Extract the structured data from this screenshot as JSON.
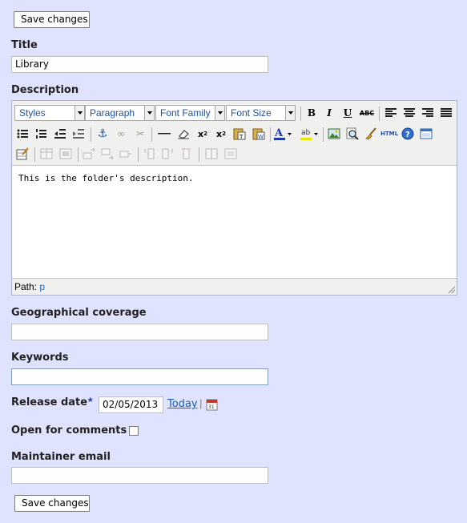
{
  "buttons": {
    "save_top": "Save changes",
    "save_bottom": "Save changes"
  },
  "fields": {
    "title": {
      "label": "Title",
      "value": "Library"
    },
    "description": {
      "label": "Description"
    },
    "geo": {
      "label": "Geographical coverage",
      "value": ""
    },
    "keywords": {
      "label": "Keywords",
      "value": ""
    },
    "release": {
      "label": "Release date",
      "required_mark": "*",
      "value": "02/05/2013",
      "today": "Today",
      "sep": "|"
    },
    "comments": {
      "label": "Open for comments"
    },
    "maintainer": {
      "label": "Maintainer email",
      "value": ""
    }
  },
  "editor": {
    "styles": "Styles",
    "paragraph": "Paragraph",
    "font_family": "Font Family",
    "font_size": "Font Size",
    "content": "This is the folder's description.",
    "path_label": "Path:",
    "path_value": "p",
    "html_label": "HTML"
  },
  "colors": {
    "background": "#dfe3fd",
    "link": "#1a5eb5",
    "required": "#1f3aa5"
  }
}
